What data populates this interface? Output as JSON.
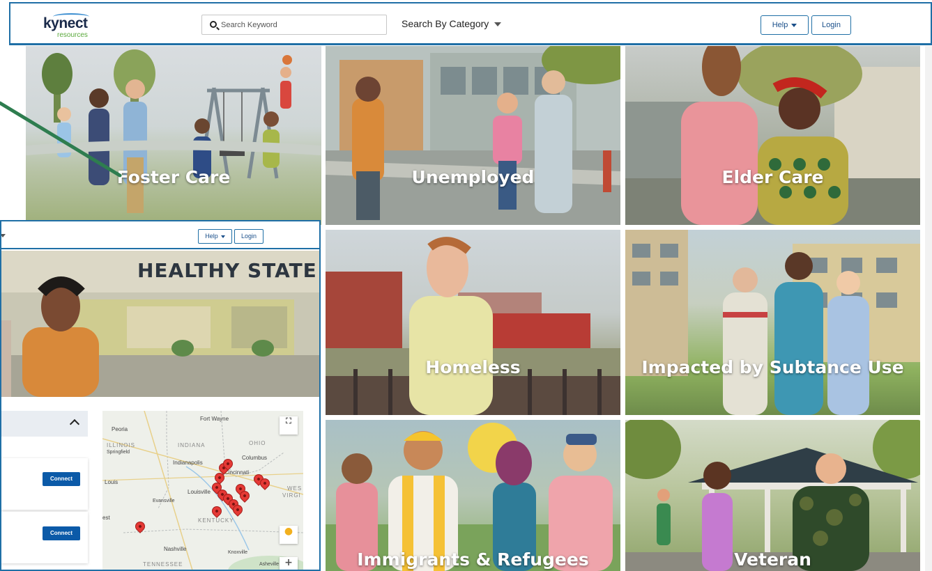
{
  "header": {
    "logo_word": "kynect",
    "logo_sub": "resources",
    "search_placeholder": "Search Keyword",
    "category_label": "Search By Category",
    "help_label": "Help",
    "login_label": "Login"
  },
  "tiles": [
    {
      "label": "Foster Care"
    },
    {
      "label": "Unemployed"
    },
    {
      "label": "Elder Care"
    },
    {
      "label": "Homeless"
    },
    {
      "label": "Impacted by Subtance Use"
    },
    {
      "label": "Immigrants & Refugees"
    },
    {
      "label": "Veteran"
    }
  ],
  "overlay": {
    "help_label": "Help",
    "login_label": "Login",
    "sign_text": "HEALTHY STATE",
    "connect_label": "Connect",
    "map_labels": {
      "peoria": "Peoria",
      "fort_wayne": "Fort Wayne",
      "illinois": "ILLINOIS",
      "springfield": "Springfield",
      "indiana": "INDIANA",
      "ohio": "OHIO",
      "indianapolis": "Indianapolis",
      "columbus": "Columbus",
      "cincinnati": "Cincinnati",
      "louis": "Louis",
      "louisville": "Louisville",
      "wes": "WES",
      "virgi": "VIRGI",
      "evansville": "Evansville",
      "est": "est",
      "kentucky": "KENTUCKY",
      "nashville": "Nashville",
      "knoxville": "Knoxville",
      "tennessee": "TENNESSEE",
      "asheville": "Asheville"
    }
  },
  "colors": {
    "brand_blue": "#1f6fa6",
    "connect_blue": "#0b5aa8",
    "arrow_green": "#2e7d4f",
    "pin_red": "#e53935"
  }
}
